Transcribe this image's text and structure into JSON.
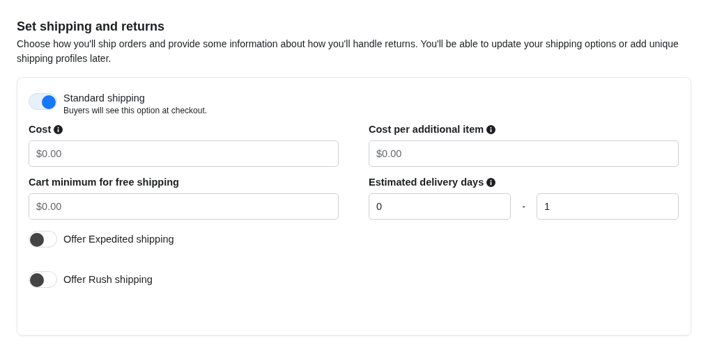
{
  "heading": "Set shipping and returns",
  "description": "Choose how you'll ship orders and provide some information about how you'll handle returns. You'll be able to update your shipping options or add unique shipping profiles later.",
  "standard_shipping": {
    "label": "Standard shipping",
    "hint": "Buyers will see this option at checkout.",
    "on": true
  },
  "fields": [
    {
      "kind": "single",
      "label": "Cost",
      "info": true,
      "placeholder": "$0.00"
    },
    {
      "kind": "single",
      "label": "Cost per additional item",
      "info": true,
      "placeholder": "$0.00"
    },
    {
      "kind": "single",
      "label": "Cart minimum for free shipping",
      "info": false,
      "placeholder": "$0.00"
    },
    {
      "kind": "range",
      "label": "Estimated delivery days",
      "info": true,
      "from": "0",
      "separator": "-",
      "to": "1"
    }
  ],
  "options": [
    {
      "label": "Offer Expedited shipping",
      "on": false
    },
    {
      "label": "Offer Rush shipping",
      "on": false
    }
  ]
}
